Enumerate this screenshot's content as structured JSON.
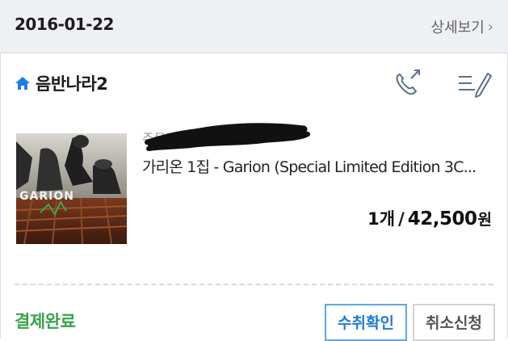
{
  "order": {
    "date": "2016-01-22",
    "detail_link": "상세보기",
    "store_name": "음반나라2",
    "order_number_label": "주문번호",
    "product_title": "가리온 1집 - Garion (Special Limited Edition 3C...",
    "album_art_text": "GARION",
    "quantity": "1개",
    "separator": "/",
    "price": "42,500",
    "currency": "원",
    "status": "결제완료"
  },
  "buttons": {
    "confirm_receipt": "수취확인",
    "cancel_request": "취소신청"
  },
  "colors": {
    "header_bg": "#eef0f3",
    "status_green": "#3aa14b",
    "confirm_blue": "#1f7bd1",
    "home_icon_blue": "#1b7ee0"
  },
  "icons": {
    "home": "home-icon",
    "phone": "phone-icon",
    "memo": "memo-icon",
    "chevron": "chevron-right-icon"
  }
}
